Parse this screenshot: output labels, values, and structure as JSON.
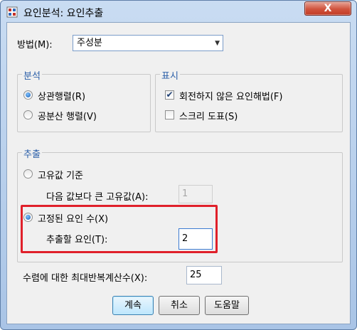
{
  "window": {
    "title": "요인분석: 요인추출",
    "close_label": "X"
  },
  "method": {
    "label": "방법(M):",
    "selected": "주성분"
  },
  "analysis": {
    "legend": "분석",
    "options": [
      {
        "label": "상관행렬(R)",
        "checked": true
      },
      {
        "label": "공분산 행렬(V)",
        "checked": false
      }
    ]
  },
  "display": {
    "legend": "표시",
    "options": [
      {
        "label": "회전하지 않은 요인해법(F)",
        "checked": true
      },
      {
        "label": "스크리 도표(S)",
        "checked": false
      }
    ]
  },
  "extract": {
    "legend": "추출",
    "eigen_label": "고유값 기준",
    "eigen_checked": false,
    "eigen_value_label": "다음 값보다 큰 고유값(A):",
    "eigen_value": "1",
    "fixed_label": "고정된 요인 수(X)",
    "fixed_checked": true,
    "fixed_count_label": "추출할 요인(T):",
    "fixed_count": "2"
  },
  "iterations": {
    "label": "수렴에 대한 최대반복계산수(X):",
    "value": "25"
  },
  "buttons": {
    "continue": "계속",
    "cancel": "취소",
    "help": "도움말"
  },
  "colors": {
    "highlight": "#e0202a",
    "legend": "#2a5ea8"
  }
}
